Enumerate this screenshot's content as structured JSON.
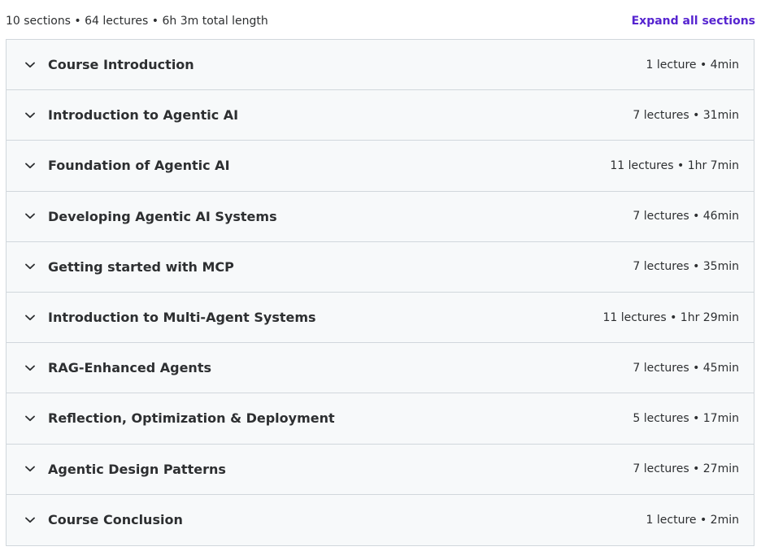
{
  "header": {
    "summary": "10 sections • 64 lectures • 6h 3m total length",
    "expand_all": "Expand all sections"
  },
  "colors": {
    "accent": "#5624d0",
    "border": "#d1d7dc",
    "section_bg": "#f7f9fa",
    "text": "#2d2f31"
  },
  "icons": {
    "section_toggle": "chevron-down-icon"
  },
  "sections": [
    {
      "title": "Course Introduction",
      "meta": "1 lecture • 4min"
    },
    {
      "title": "Introduction to Agentic AI",
      "meta": "7 lectures • 31min"
    },
    {
      "title": "Foundation of Agentic AI",
      "meta": "11 lectures • 1hr 7min"
    },
    {
      "title": "Developing Agentic AI Systems",
      "meta": "7 lectures • 46min"
    },
    {
      "title": "Getting started with MCP",
      "meta": "7 lectures • 35min"
    },
    {
      "title": "Introduction to Multi-Agent Systems",
      "meta": "11 lectures • 1hr 29min"
    },
    {
      "title": "RAG-Enhanced Agents",
      "meta": "7 lectures • 45min"
    },
    {
      "title": "Reflection, Optimization & Deployment",
      "meta": "5 lectures • 17min"
    },
    {
      "title": "Agentic Design Patterns",
      "meta": "7 lectures • 27min"
    },
    {
      "title": "Course Conclusion",
      "meta": "1 lecture • 2min"
    }
  ]
}
